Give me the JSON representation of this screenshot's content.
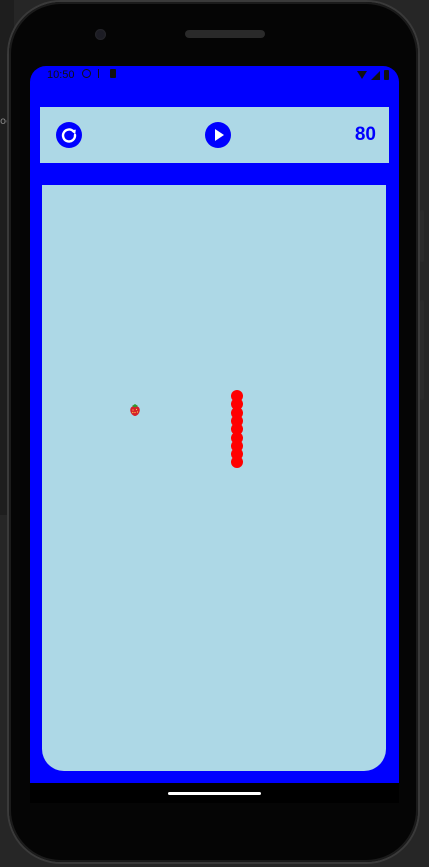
{
  "background": {
    "side_text": "oo"
  },
  "status_bar": {
    "time": "10:50",
    "left_icons": [
      "sync-icon",
      "key-icon",
      "sd-card-icon"
    ],
    "right_icons": [
      "wifi-icon",
      "signal-icon",
      "battery-icon"
    ]
  },
  "toolbar": {
    "restart_icon": "restart-icon",
    "play_icon": "play-icon",
    "score": "80"
  },
  "game": {
    "food_icon": "strawberry-icon",
    "snake_length": 9,
    "snake_direction": "vertical",
    "colors": {
      "screen_bg": "#0000ff",
      "board_bg": "#add8e6",
      "snake": "#ff0000",
      "accent": "#0000ff"
    }
  }
}
